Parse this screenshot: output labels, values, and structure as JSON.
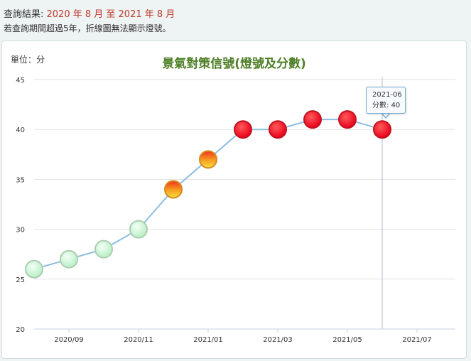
{
  "query": {
    "label": "查詢結果: ",
    "range": "2020 年 8 月 至 2021 年 8 月"
  },
  "note": "若查詢期間超過5年，折線圖無法顯示燈號。",
  "unit_label": "單位：分",
  "tooltip": {
    "date": "2021-06",
    "value_text": "分數: 40"
  },
  "colors": {
    "line": "#8cbde2",
    "green_signal": "#c8f5d2",
    "yellow_red_signal": "#f6c020",
    "red_signal": "#f0001e",
    "title": "#4d7e25",
    "query_range": "#c0392b"
  },
  "chart_data": {
    "type": "line",
    "title": "景氣對策信號(燈號及分數)",
    "ylabel": "單位：分",
    "xlabel": "",
    "ylim": [
      20,
      45
    ],
    "yticks": [
      20,
      25,
      30,
      35,
      40,
      45
    ],
    "xtick_labels": [
      "2020/09",
      "2020/11",
      "2021/01",
      "2021/03",
      "2021/05",
      "2021/07"
    ],
    "xlim": [
      "2020-08",
      "2021-08"
    ],
    "grid": true,
    "series": [
      {
        "x": [
          "2020-08",
          "2020-09",
          "2020-10",
          "2020-11",
          "2020-12",
          "2021-01",
          "2021-02",
          "2021-03",
          "2021-04",
          "2021-05",
          "2021-06"
        ],
        "values": [
          26,
          27,
          28,
          30,
          34,
          37,
          40,
          40,
          41,
          41,
          40
        ],
        "signals": [
          "green",
          "green",
          "green",
          "green",
          "yellow-red",
          "yellow-red",
          "red",
          "red",
          "red",
          "red",
          "red"
        ]
      }
    ],
    "highlighted": {
      "x": "2021-06",
      "value": 40
    }
  }
}
